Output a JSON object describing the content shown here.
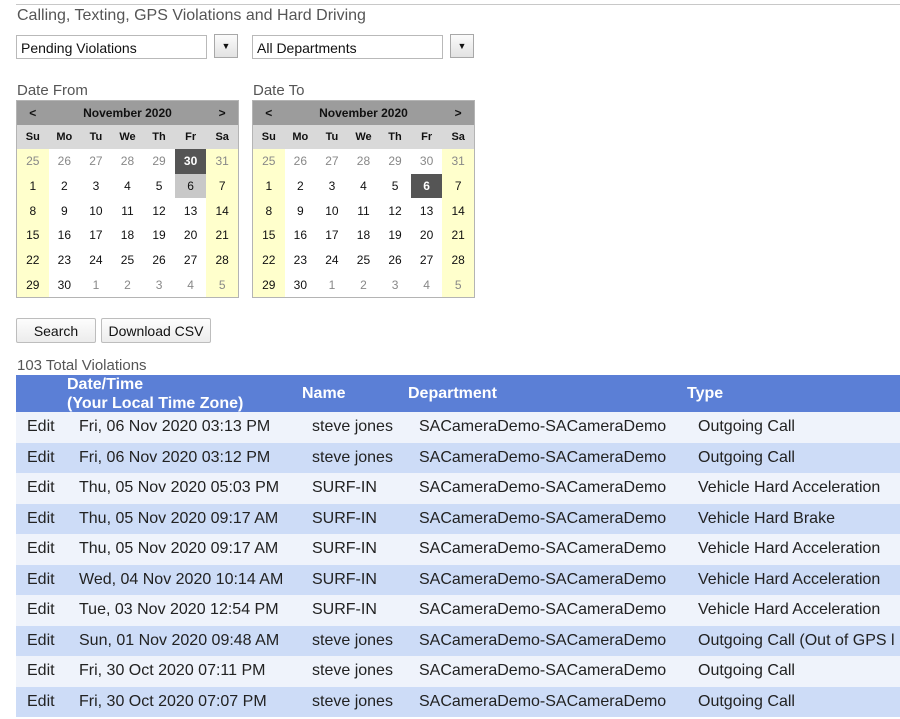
{
  "page": {
    "title": "Calling, Texting, GPS Violations and Hard Driving"
  },
  "filters": {
    "status_value": "Pending Violations",
    "department_value": "All Departments"
  },
  "date_from": {
    "label": "Date From",
    "prev": "<",
    "next": ">",
    "month_title": "November 2020",
    "weekdays": [
      "Su",
      "Mo",
      "Tu",
      "We",
      "Th",
      "Fr",
      "Sa"
    ],
    "weeks": [
      [
        "25",
        "26",
        "27",
        "28",
        "29",
        "30",
        "31"
      ],
      [
        "1",
        "2",
        "3",
        "4",
        "5",
        "6",
        "7"
      ],
      [
        "8",
        "9",
        "10",
        "11",
        "12",
        "13",
        "14"
      ],
      [
        "15",
        "16",
        "17",
        "18",
        "19",
        "20",
        "21"
      ],
      [
        "22",
        "23",
        "24",
        "25",
        "26",
        "27",
        "28"
      ],
      [
        "29",
        "30",
        "1",
        "2",
        "3",
        "4",
        "5"
      ]
    ],
    "selected": [
      0,
      5
    ],
    "highlight": [
      1,
      5
    ]
  },
  "date_to": {
    "label": "Date To",
    "prev": "<",
    "next": ">",
    "month_title": "November 2020",
    "weekdays": [
      "Su",
      "Mo",
      "Tu",
      "We",
      "Th",
      "Fr",
      "Sa"
    ],
    "weeks": [
      [
        "25",
        "26",
        "27",
        "28",
        "29",
        "30",
        "31"
      ],
      [
        "1",
        "2",
        "3",
        "4",
        "5",
        "6",
        "7"
      ],
      [
        "8",
        "9",
        "10",
        "11",
        "12",
        "13",
        "14"
      ],
      [
        "15",
        "16",
        "17",
        "18",
        "19",
        "20",
        "21"
      ],
      [
        "22",
        "23",
        "24",
        "25",
        "26",
        "27",
        "28"
      ],
      [
        "29",
        "30",
        "1",
        "2",
        "3",
        "4",
        "5"
      ]
    ],
    "selected": [
      1,
      5
    ]
  },
  "actions": {
    "search_label": "Search",
    "download_label": "Download CSV"
  },
  "total": "103 Total Violations",
  "table": {
    "columns": {
      "datetime_line1": "Date/Time",
      "datetime_line2": "(Your Local Time Zone)",
      "name": "Name",
      "department": "Department",
      "type": "Type"
    },
    "edit_label": "Edit",
    "rows": [
      {
        "datetime": "Fri, 06 Nov 2020 03:13 PM",
        "name": "steve jones",
        "department": "SACameraDemo-SACameraDemo",
        "type": "Outgoing Call"
      },
      {
        "datetime": "Fri, 06 Nov 2020 03:12 PM",
        "name": "steve jones",
        "department": "SACameraDemo-SACameraDemo",
        "type": "Outgoing Call"
      },
      {
        "datetime": "Thu, 05 Nov 2020 05:03 PM",
        "name": "SURF-IN",
        "department": "SACameraDemo-SACameraDemo",
        "type": "Vehicle Hard Acceleration"
      },
      {
        "datetime": "Thu, 05 Nov 2020 09:17 AM",
        "name": "SURF-IN",
        "department": "SACameraDemo-SACameraDemo",
        "type": "Vehicle Hard Brake"
      },
      {
        "datetime": "Thu, 05 Nov 2020 09:17 AM",
        "name": "SURF-IN",
        "department": "SACameraDemo-SACameraDemo",
        "type": "Vehicle Hard Acceleration"
      },
      {
        "datetime": "Wed, 04 Nov 2020 10:14 AM",
        "name": "SURF-IN",
        "department": "SACameraDemo-SACameraDemo",
        "type": "Vehicle Hard Acceleration"
      },
      {
        "datetime": "Tue, 03 Nov 2020 12:54 PM",
        "name": "SURF-IN",
        "department": "SACameraDemo-SACameraDemo",
        "type": "Vehicle Hard Acceleration"
      },
      {
        "datetime": "Sun, 01 Nov 2020 09:48 AM",
        "name": "steve jones",
        "department": "SACameraDemo-SACameraDemo",
        "type": "Outgoing Call (Out of GPS l"
      },
      {
        "datetime": "Fri, 30 Oct 2020 07:11 PM",
        "name": "steve jones",
        "department": "SACameraDemo-SACameraDemo",
        "type": "Outgoing Call"
      },
      {
        "datetime": "Fri, 30 Oct 2020 07:07 PM",
        "name": "steve jones",
        "department": "SACameraDemo-SACameraDemo",
        "type": "Outgoing Call"
      }
    ]
  }
}
